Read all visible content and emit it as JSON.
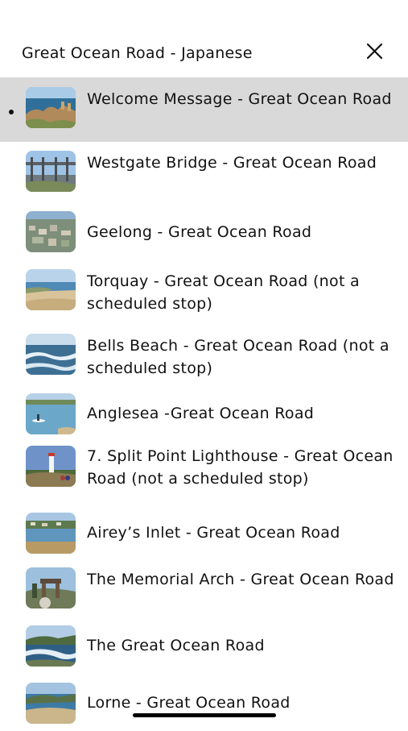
{
  "header": {
    "title": "Great Ocean Road - Japanese",
    "close_icon": "close-icon"
  },
  "tracks": [
    {
      "label": "Welcome Message - Great Ocean Road",
      "active": true,
      "thumb": "coastline-cliffs"
    },
    {
      "label": "Westgate Bridge - Great Ocean Road",
      "active": false,
      "thumb": "bridge"
    },
    {
      "label": "Geelong - Great Ocean Road",
      "active": false,
      "thumb": "city-aerial"
    },
    {
      "label": "Torquay - Great Ocean Road (not a scheduled stop)",
      "active": false,
      "thumb": "beach"
    },
    {
      "label": "Bells Beach - Great Ocean Road (not a scheduled stop)",
      "active": false,
      "thumb": "surf-waves"
    },
    {
      "label": "Anglesea -Great Ocean Road",
      "active": false,
      "thumb": "river-kayak"
    },
    {
      "label": "7. Split Point Lighthouse - Great Ocean Road (not a scheduled stop)",
      "active": false,
      "thumb": "lighthouse"
    },
    {
      "label": "Airey’s Inlet - Great Ocean Road",
      "active": false,
      "thumb": "inlet-town"
    },
    {
      "label": "The Memorial Arch - Great Ocean Road",
      "active": false,
      "thumb": "memorial-arch"
    },
    {
      "label": "The Great Ocean Road",
      "active": false,
      "thumb": "coastal-road"
    },
    {
      "label": "Lorne - Great Ocean Road",
      "active": false,
      "thumb": "lorne-coast"
    }
  ]
}
